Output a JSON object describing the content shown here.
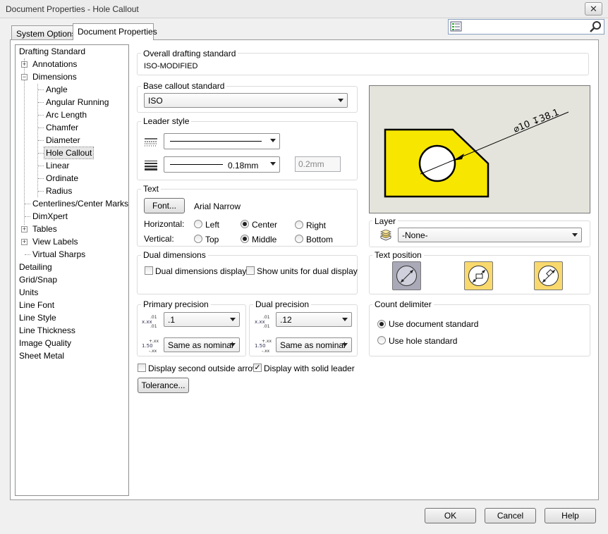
{
  "window": {
    "title": "Document Properties - Hole Callout",
    "close_glyph": "✕"
  },
  "tabs": [
    {
      "label": "System Options"
    },
    {
      "label": "Document Properties"
    }
  ],
  "search": {
    "value": ""
  },
  "tree": [
    {
      "label": "Drafting Standard"
    },
    {
      "label": "Annotations"
    },
    {
      "label": "Dimensions"
    },
    {
      "label": "Angle"
    },
    {
      "label": "Angular Running"
    },
    {
      "label": "Arc Length"
    },
    {
      "label": "Chamfer"
    },
    {
      "label": "Diameter"
    },
    {
      "label": "Hole Callout"
    },
    {
      "label": "Linear"
    },
    {
      "label": "Ordinate"
    },
    {
      "label": "Radius"
    },
    {
      "label": "Centerlines/Center Marks"
    },
    {
      "label": "DimXpert"
    },
    {
      "label": "Tables"
    },
    {
      "label": "View Labels"
    },
    {
      "label": "Virtual Sharps"
    },
    {
      "label": "Detailing"
    },
    {
      "label": "Grid/Snap"
    },
    {
      "label": "Units"
    },
    {
      "label": "Line Font"
    },
    {
      "label": "Line Style"
    },
    {
      "label": "Line Thickness"
    },
    {
      "label": "Image Quality"
    },
    {
      "label": "Sheet Metal"
    }
  ],
  "overall": {
    "label": "Overall drafting standard",
    "value": "ISO-MODIFIED"
  },
  "base": {
    "label": "Base callout standard",
    "value": "ISO"
  },
  "leader": {
    "label": "Leader style",
    "thickness": "0.18mm",
    "custom": "0.2mm"
  },
  "text": {
    "label": "Text",
    "font_button": "Font...",
    "font_name": "Arial Narrow",
    "horizontal_label": "Horizontal:",
    "vertical_label": "Vertical:",
    "h_left": "Left",
    "h_center": "Center",
    "h_right": "Right",
    "v_top": "Top",
    "v_middle": "Middle",
    "v_bottom": "Bottom"
  },
  "dual": {
    "label": "Dual dimensions",
    "display": "Dual dimensions display",
    "units": "Show units for dual display"
  },
  "primary": {
    "label": "Primary precision",
    "value": ".1",
    "tol": "Same as nominal"
  },
  "dualprec": {
    "label": "Dual precision",
    "value": ".12",
    "tol": "Same as nominal"
  },
  "options": {
    "outside_arrow": "Display second outside arrow",
    "solid_leader": "Display with solid leader",
    "tolerance_button": "Tolerance..."
  },
  "preview": {
    "callout": "⌀10 ↧38.1",
    "fill_color": "#f7e600"
  },
  "layer": {
    "label": "Layer",
    "value": "-None-"
  },
  "textpos": {
    "label": "Text position"
  },
  "count": {
    "label": "Count delimiter",
    "doc": "Use document standard",
    "hole": "Use hole standard"
  },
  "footer": {
    "ok": "OK",
    "cancel": "Cancel",
    "help": "Help"
  }
}
